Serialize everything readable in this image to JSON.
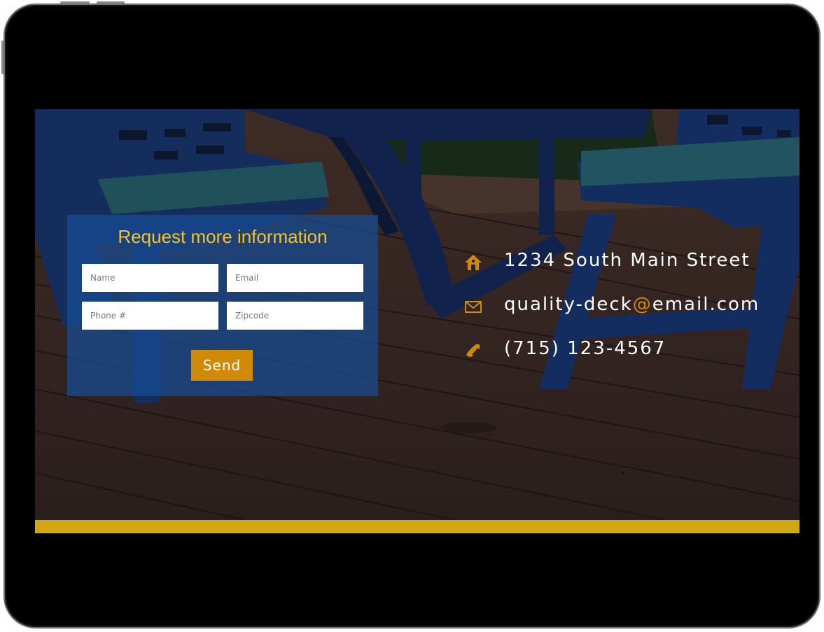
{
  "form": {
    "title": "Request more information",
    "fields": {
      "name_placeholder": "Name",
      "email_placeholder": "Email",
      "phone_placeholder": "Phone #",
      "zipcode_placeholder": "Zipcode"
    },
    "send_label": "Send"
  },
  "contact": {
    "address": "1234 South Main Street",
    "email_user": "quality-deck",
    "email_at": "@",
    "email_domain": "email.com",
    "phone": "(715) 123-4567",
    "icons": [
      "home-icon",
      "envelope-icon",
      "phone-icon"
    ]
  },
  "colors": {
    "title_gold": "#f2c22a",
    "accent_orange": "#d18a07",
    "footer_bar": "#d1a712",
    "panel_blue": "#164c96"
  }
}
